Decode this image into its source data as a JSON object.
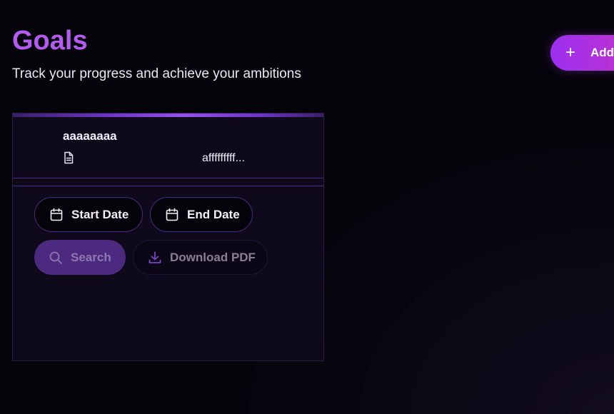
{
  "header": {
    "title": "Goals",
    "subtitle": "Track your progress and achieve your ambitions",
    "add_button_label": "Add Goal"
  },
  "goal_card": {
    "name": "aaaaaaaa",
    "description": "afffffffff...",
    "icons": {
      "description": "document-icon"
    }
  },
  "filters": {
    "start_date_label": "Start Date",
    "end_date_label": "End Date",
    "search_label": "Search",
    "download_label": "Download PDF",
    "icons": {
      "start_date": "calendar-icon",
      "end_date": "calendar-icon",
      "search": "search-icon",
      "download": "download-icon"
    }
  },
  "colors": {
    "accent": "#b45cf0",
    "button_gradient_start": "#9d2ff0",
    "button_gradient_end": "#c236c8",
    "card_background": "#0e0a1c",
    "search_background": "#4c2a80",
    "page_background": "#06040b"
  }
}
